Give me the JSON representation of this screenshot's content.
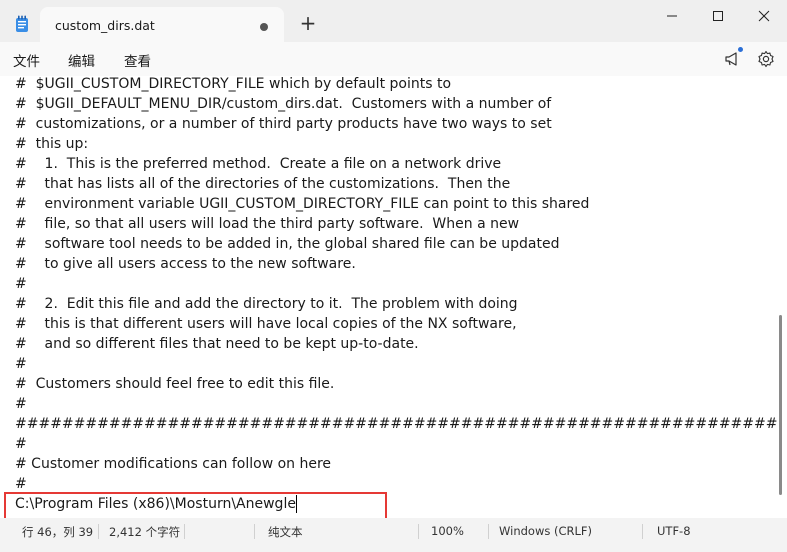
{
  "window": {
    "tab_title": "custom_dirs.dat",
    "new_tab_label": "+"
  },
  "menu": {
    "file": "文件",
    "edit": "编辑",
    "view": "查看"
  },
  "editor": {
    "lines": [
      "#  $UGII_CUSTOM_DIRECTORY_FILE which by default points to",
      "#  $UGII_DEFAULT_MENU_DIR/custom_dirs.dat.  Customers with a number of",
      "#  customizations, or a number of third party products have two ways to set",
      "#  this up:",
      "#    1.  This is the preferred method.  Create a file on a network drive",
      "#    that has lists all of the directories of the customizations.  Then the",
      "#    environment variable UGII_CUSTOM_DIRECTORY_FILE can point to this shared",
      "#    file, so that all users will load the third party software.  When a new",
      "#    software tool needs to be added in, the global shared file can be updated",
      "#    to give all users access to the new software.",
      "#",
      "#    2.  Edit this file and add the directory to it.  The problem with doing",
      "#    this is that different users will have local copies of the NX software,",
      "#    and so different files that need to be kept up-to-date.",
      "#",
      "#  Customers should feel free to edit this file.",
      "#",
      "#################################################################",
      "#",
      "# Customer modifications can follow on here",
      "#",
      "C:\\Program Files (x86)\\Mosturn\\Anewgle"
    ]
  },
  "status": {
    "position": "行 46，列 39",
    "char_count": "2,412 个字符",
    "format": "纯文本",
    "zoom": "100%",
    "line_ending": "Windows (CRLF)",
    "encoding": "UTF-8"
  },
  "colors": {
    "highlight_border": "#e53935",
    "editor_bg": "#ffffff",
    "chrome_bg": "#f3f3f3"
  }
}
